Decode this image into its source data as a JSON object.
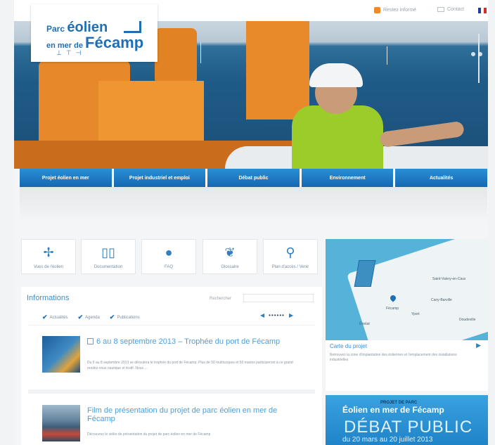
{
  "utility": {
    "rss": "Restez informé",
    "contact": "Contact"
  },
  "logo": {
    "line1_prefix": "Parc",
    "line1_main": "éolien",
    "line2_prefix": "en mer de",
    "line2_main": "Fécamp"
  },
  "nav": {
    "items": [
      {
        "label": "Projet éolien en mer"
      },
      {
        "label": "Projet industriel et emploi"
      },
      {
        "label": "Débat public"
      },
      {
        "label": "Environnement"
      },
      {
        "label": "Actualités"
      }
    ]
  },
  "quicklinks": [
    {
      "label": "Vues de l'éolien",
      "icon": "turbine-icon"
    },
    {
      "label": "Documentation",
      "icon": "book-icon"
    },
    {
      "label": "FAQ",
      "icon": "chat-icon"
    },
    {
      "label": "Glossaire",
      "icon": "feather-icon"
    },
    {
      "label": "Plan d'accès / Venir",
      "icon": "map-pin-icon"
    }
  ],
  "info": {
    "title": "Informations",
    "search_label": "Rechercher",
    "filters": [
      "Actualités",
      "Agenda",
      "Publications"
    ],
    "pager_dots": "••••••",
    "news": [
      {
        "title": "6 au 8 septembre 2013 – Trophée du port de Fécamp",
        "desc": "Du 6 au 8 septembre 2013 se déroulera le trophée du port de Fécamp. Plus de 50 multicoques et 50 marins participeront à ce grand rendez-vous nautique et festif. Nous ..."
      },
      {
        "title": "Film de présentation du projet de parc éolien en mer de Fécamp",
        "desc": "Découvrez le vidéo de présentation du projet de parc éolien en mer de Fécamp"
      }
    ]
  },
  "map": {
    "title": "Carte du projet",
    "desc": "Retrouvez la zone d'implantation des éoliennes et l'emplacement des installations industrielles",
    "towns": [
      "Saint-Valery-en-Caux",
      "Cany-Barville",
      "Fécamp",
      "Yport",
      "Étretat",
      "Doudeville"
    ]
  },
  "debat": {
    "small": "PROJET DE PARC",
    "logo": "Éolien en mer de Fécamp",
    "big": "DÉBAT PUBLIC",
    "dates": "du 20 mars au 20 juillet 2013"
  },
  "colors": {
    "nav_blue": "#1f78c4",
    "link_blue": "#3b8fd4",
    "rss_orange": "#f08a24"
  }
}
